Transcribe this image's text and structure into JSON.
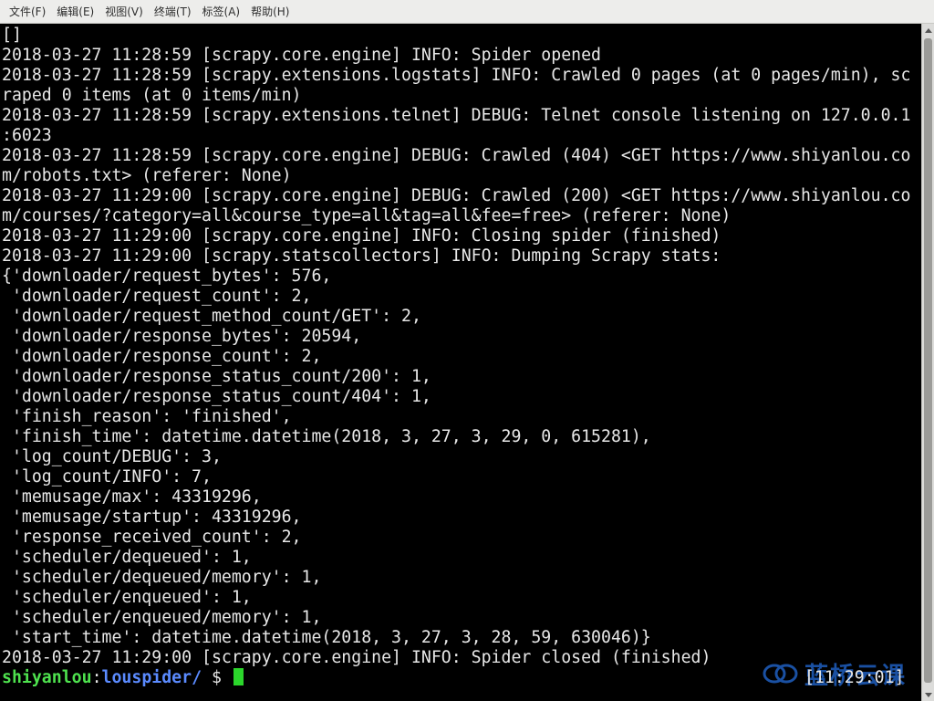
{
  "menubar": {
    "items": [
      "文件(F)",
      "编辑(E)",
      "视图(V)",
      "终端(T)",
      "标签(A)",
      "帮助(H)"
    ]
  },
  "terminal": {
    "lines": [
      "[]",
      "2018-03-27 11:28:59 [scrapy.core.engine] INFO: Spider opened",
      "2018-03-27 11:28:59 [scrapy.extensions.logstats] INFO: Crawled 0 pages (at 0 pages/min), sc",
      "raped 0 items (at 0 items/min)",
      "2018-03-27 11:28:59 [scrapy.extensions.telnet] DEBUG: Telnet console listening on 127.0.0.1",
      ":6023",
      "2018-03-27 11:28:59 [scrapy.core.engine] DEBUG: Crawled (404) <GET https://www.shiyanlou.co",
      "m/robots.txt> (referer: None)",
      "2018-03-27 11:29:00 [scrapy.core.engine] DEBUG: Crawled (200) <GET https://www.shiyanlou.co",
      "m/courses/?category=all&course_type=all&tag=all&fee=free> (referer: None)",
      "2018-03-27 11:29:00 [scrapy.core.engine] INFO: Closing spider (finished)",
      "2018-03-27 11:29:00 [scrapy.statscollectors] INFO: Dumping Scrapy stats:",
      "{'downloader/request_bytes': 576,",
      " 'downloader/request_count': 2,",
      " 'downloader/request_method_count/GET': 2,",
      " 'downloader/response_bytes': 20594,",
      " 'downloader/response_count': 2,",
      " 'downloader/response_status_count/200': 1,",
      " 'downloader/response_status_count/404': 1,",
      " 'finish_reason': 'finished',",
      " 'finish_time': datetime.datetime(2018, 3, 27, 3, 29, 0, 615281),",
      " 'log_count/DEBUG': 3,",
      " 'log_count/INFO': 7,",
      " 'memusage/max': 43319296,",
      " 'memusage/startup': 43319296,",
      " 'response_received_count': 2,",
      " 'scheduler/dequeued': 1,",
      " 'scheduler/dequeued/memory': 1,",
      " 'scheduler/enqueued': 1,",
      " 'scheduler/enqueued/memory': 1,",
      " 'start_time': datetime.datetime(2018, 3, 27, 3, 28, 59, 630046)}",
      "2018-03-27 11:29:00 [scrapy.core.engine] INFO: Spider closed (finished)"
    ],
    "prompt": {
      "user": "shiyanlou",
      "separator": ":",
      "path": "louspider/",
      "dollar": " $ "
    },
    "clock": "[11:29:01]"
  },
  "watermark": {
    "text": "蓝桥云课"
  },
  "colors": {
    "background": "#000000",
    "foreground": "#e8e8e8",
    "prompt_user": "#4ee24e",
    "prompt_path": "#5b8bff",
    "cursor": "#2bd62b",
    "watermark": "#1f5fbf"
  }
}
